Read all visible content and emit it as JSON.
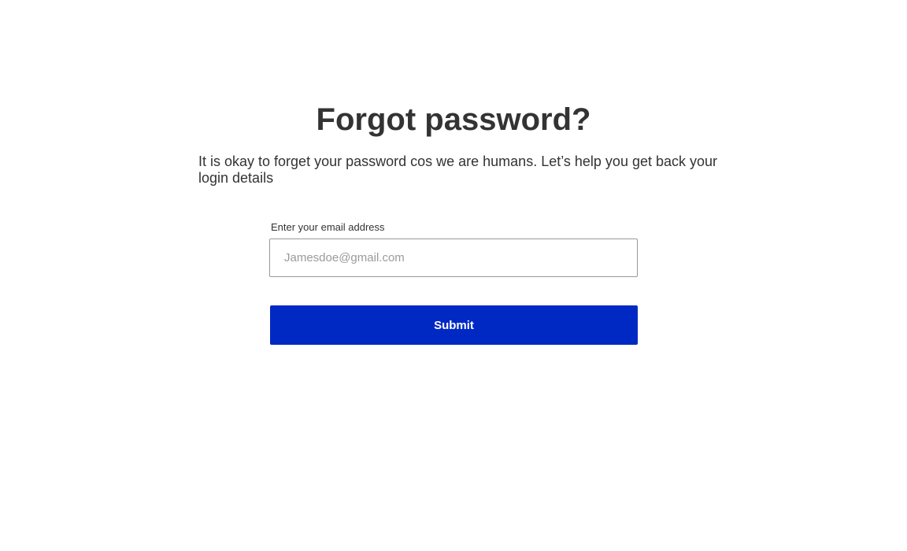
{
  "header": {
    "title": "Forgot password?",
    "subtitle": "It is okay to forget your password cos we are humans. Let’s help you get back your login details"
  },
  "form": {
    "email_label": "Enter your email address",
    "email_placeholder": "Jamesdoe@gmail.com",
    "email_value": "",
    "submit_label": "Submit"
  },
  "colors": {
    "accent": "#0029c4",
    "text": "#333333",
    "placeholder": "#9a9a9a",
    "input_border": "#999999"
  }
}
